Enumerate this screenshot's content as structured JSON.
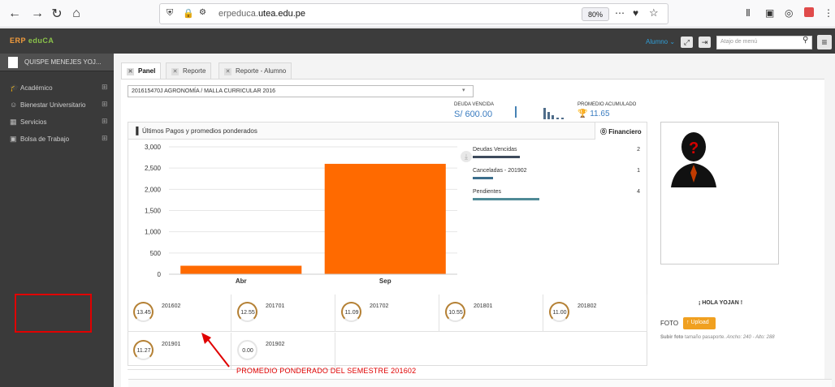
{
  "browser": {
    "url_prefix": "erpeduca.",
    "url_domain": "utea.edu.pe",
    "zoom": "80%"
  },
  "header": {
    "brand_a": "ERP",
    "brand_b": "eduCA",
    "role": "Alumno ⌄",
    "search_placeholder": "Atajo de menú"
  },
  "sidebar": {
    "user": "QUISPE MENEJES YOJ...",
    "items": [
      {
        "label": "Académico"
      },
      {
        "label": "Bienestar Universitario"
      },
      {
        "label": "Servicios"
      },
      {
        "label": "Bolsa de Trabajo"
      }
    ]
  },
  "tabs": [
    {
      "label": "Panel"
    },
    {
      "label": "Reporte"
    },
    {
      "label": "Reporte - Alumno"
    }
  ],
  "career": "201615470J AGRONOMÍA / MALLA CURRICULAR 2016",
  "debt": {
    "label": "DEUDA VENCIDA",
    "value": "S/ 600.00"
  },
  "average": {
    "label": "PROMEDIO ACUMULADO",
    "value": "11.65"
  },
  "chart_panel": {
    "title": "Últimos Pagos y promedios ponderados",
    "tab": "Financiero"
  },
  "chart_data": {
    "type": "bar",
    "categories": [
      "Abr",
      "Sep"
    ],
    "values": [
      200,
      2600
    ],
    "ylim": [
      0,
      3000
    ],
    "yticks": [
      "0",
      "500",
      "1,000",
      "1,500",
      "2,000",
      "2,500",
      "3,000"
    ],
    "color": "#ff6a00"
  },
  "stats": [
    {
      "label": "Deudas Vencidas",
      "count": "2",
      "fill": 0.28,
      "color": "#3d4a5c"
    },
    {
      "label": "Canceladas - 201902",
      "count": "1",
      "fill": 0.12,
      "color": "#3b6e8c"
    },
    {
      "label": "Pendientes",
      "count": "4",
      "fill": 0.4,
      "color": "#4f8a96"
    }
  ],
  "semesters": [
    {
      "value": "13.45",
      "code": "201602",
      "fill": 0.67
    },
    {
      "value": "12.55",
      "code": "201701",
      "fill": 0.63
    },
    {
      "value": "11.09",
      "code": "201702",
      "fill": 0.55
    },
    {
      "value": "10.55",
      "code": "201801",
      "fill": 0.53
    },
    {
      "value": "11.00",
      "code": "201802",
      "fill": 0.55
    },
    {
      "value": "11.27",
      "code": "201901",
      "fill": 0.56
    },
    {
      "value": "0.00",
      "code": "201902",
      "fill": 0
    }
  ],
  "profile": {
    "greeting": "¡ HOLA YOJAN !",
    "foto_label": "FOTO",
    "upload_label": "Upload",
    "help_bold": "Subir foto",
    "help_text": " tamaño pasaporte.",
    "help_italic": " Ancho: 240 - Alto: 288"
  },
  "annotation": "PROMEDIO PONDERADO DEL SEMESTRE 201602"
}
